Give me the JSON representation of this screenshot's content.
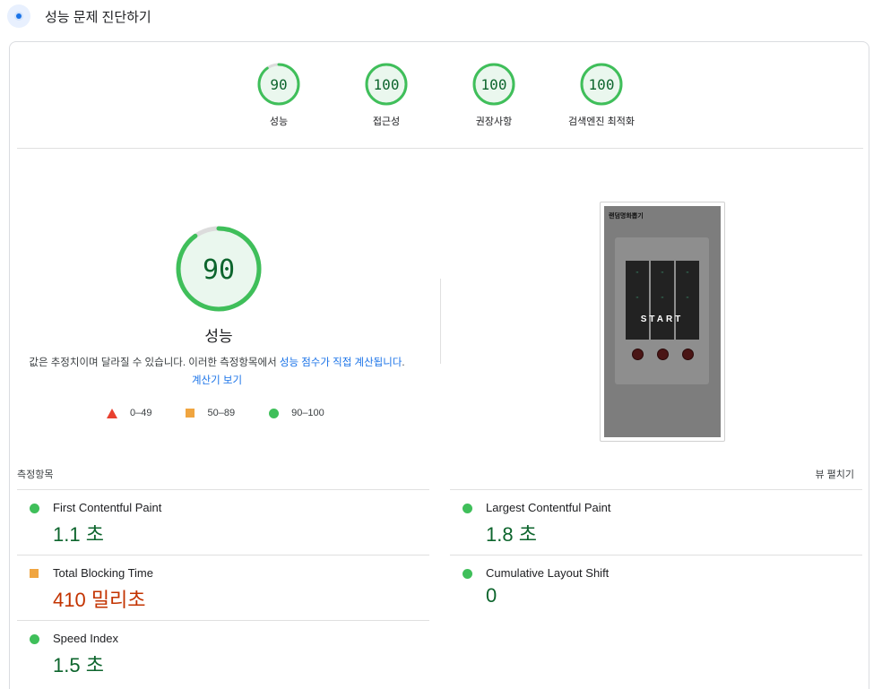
{
  "header": {
    "title": "성능 문제 진단하기",
    "icon": "lighthouse-icon"
  },
  "gauges": [
    {
      "score": "90",
      "label": "성능",
      "percent": 90
    },
    {
      "score": "100",
      "label": "접근성",
      "percent": 100
    },
    {
      "score": "100",
      "label": "권장사항",
      "percent": 100
    },
    {
      "score": "100",
      "label": "검색엔진 최적화",
      "percent": 100
    }
  ],
  "performance": {
    "score": "90",
    "percent": 90,
    "label": "성능",
    "desc_prefix": "값은 추정치이며 달라질 수 있습니다. 이러한 측정항목에서 ",
    "desc_link1": "성능 점수가 직접 계산됩니다",
    "desc_mid": ". ",
    "desc_link2": "계산기 보기"
  },
  "legend": [
    {
      "range": "0–49",
      "shape": "triangle",
      "color": "#e8402f"
    },
    {
      "range": "50–89",
      "shape": "square",
      "color": "#f0a540"
    },
    {
      "range": "90–100",
      "shape": "circle",
      "color": "#3fbf5a"
    }
  ],
  "screenshot": {
    "title": "랜덤명화뽑기",
    "overlay_text": "START"
  },
  "metrics": {
    "title": "측정항목",
    "toggle_label": "뷰 펼치기",
    "items": [
      {
        "name": "First Contentful Paint",
        "value": "1.1 초",
        "status": "pass"
      },
      {
        "name": "Largest Contentful Paint",
        "value": "1.8 초",
        "status": "pass"
      },
      {
        "name": "Total Blocking Time",
        "value": "410 밀리초",
        "status": "average"
      },
      {
        "name": "Cumulative Layout Shift",
        "value": "0",
        "status": "pass"
      },
      {
        "name": "Speed Index",
        "value": "1.5 초",
        "status": "pass"
      }
    ]
  },
  "colors": {
    "pass": "#0d652d",
    "average": "#c33300",
    "gauge_ring": "#3fbf5a",
    "gauge_bg": "#eaf7ee"
  }
}
